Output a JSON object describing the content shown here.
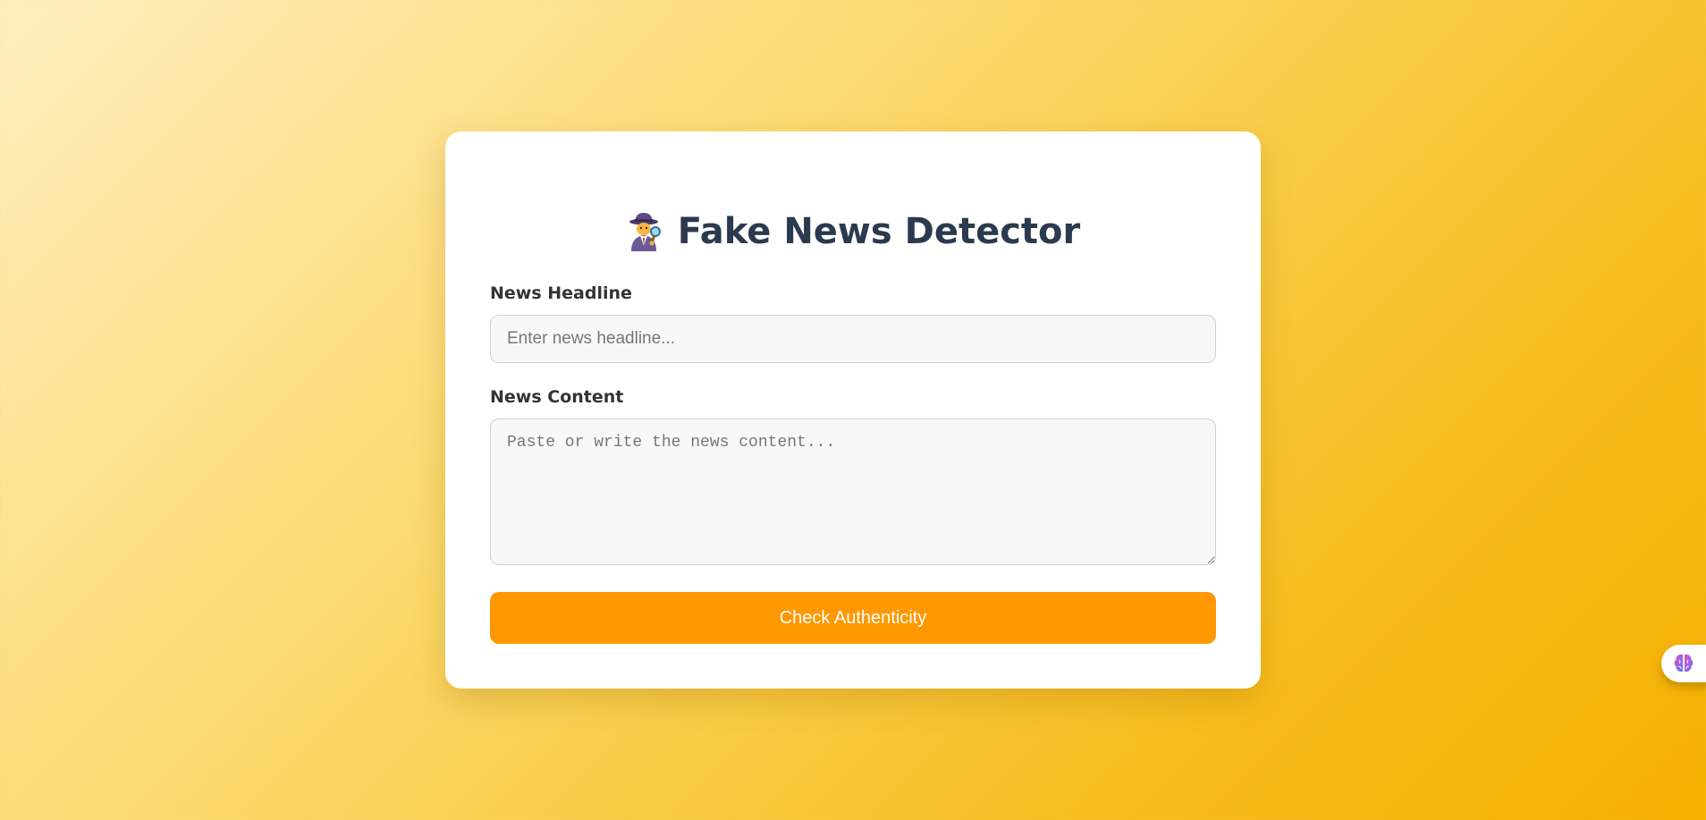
{
  "app": {
    "title": "Fake News Detector",
    "title_icon": "detective-icon"
  },
  "form": {
    "headline_label": "News Headline",
    "headline_placeholder": "Enter news headline...",
    "headline_value": "",
    "content_label": "News Content",
    "content_placeholder": "Paste or write the news content...",
    "content_value": "",
    "submit_label": "Check Authenticity"
  },
  "widget": {
    "icon": "brain-icon"
  },
  "colors": {
    "accent": "#ff9800",
    "title_text": "#2b3a4e",
    "background_start": "#ffeebf",
    "background_end": "#f5b000"
  }
}
